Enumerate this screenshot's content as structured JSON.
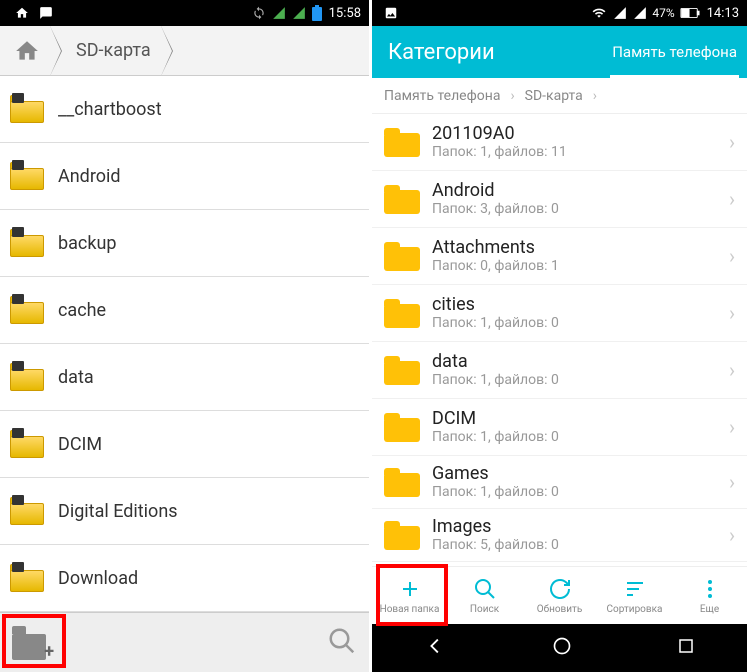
{
  "left": {
    "status": {
      "time": "15:58"
    },
    "breadcrumb": {
      "current": "SD-карта"
    },
    "folders": [
      {
        "name": "__chartboost"
      },
      {
        "name": "Android"
      },
      {
        "name": "backup"
      },
      {
        "name": "cache"
      },
      {
        "name": "data"
      },
      {
        "name": "DCIM"
      },
      {
        "name": "Digital Editions"
      },
      {
        "name": "Download"
      }
    ]
  },
  "right": {
    "status": {
      "battery": "47%",
      "time": "14:13"
    },
    "header": {
      "title": "Категории",
      "tab": "Память телефона"
    },
    "breadcrumb": {
      "root": "Память телефона",
      "current": "SD-карта"
    },
    "folders": [
      {
        "name": "201109A0",
        "sub": "Папок: 1, файлов: 11"
      },
      {
        "name": "Android",
        "sub": "Папок: 3, файлов: 0"
      },
      {
        "name": "Attachments",
        "sub": "Папок: 0, файлов: 1"
      },
      {
        "name": "cities",
        "sub": "Папок: 1, файлов: 0"
      },
      {
        "name": "data",
        "sub": "Папок: 1, файлов: 0"
      },
      {
        "name": "DCIM",
        "sub": "Папок: 1, файлов: 0"
      },
      {
        "name": "Games",
        "sub": "Папок: 1, файлов: 0"
      },
      {
        "name": "Images",
        "sub": "Папок: 5, файлов: 0"
      }
    ],
    "toolbar": {
      "new_folder": "Новая папка",
      "search": "Поиск",
      "refresh": "Обновить",
      "sort": "Сортировка",
      "more": "Еще"
    }
  }
}
